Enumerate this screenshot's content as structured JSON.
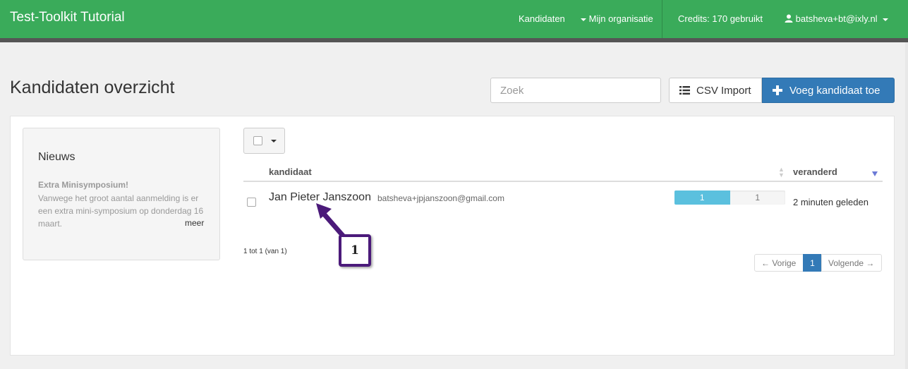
{
  "navbar": {
    "brand": "Test-Toolkit Tutorial",
    "candidates": "Kandidaten",
    "organisation": "Mijn organisatie",
    "credits": "Credits: 170 gebruikt",
    "user": "batsheva+bt@ixly.nl"
  },
  "page": {
    "title": "Kandidaten overzicht",
    "search_placeholder": "Zoek",
    "csv_import": "CSV Import",
    "add_candidate": "Voeg kandidaat toe"
  },
  "news": {
    "title": "Nieuws",
    "headline": "Extra Minisymposium!",
    "body": "Vanwege het groot aantal aanmelding is er een extra mini-symposium op donderdag 16 maart.",
    "more": "meer"
  },
  "table": {
    "headers": {
      "candidate": "kandidaat",
      "changed": "veranderd"
    },
    "rows": [
      {
        "name": "Jan Pieter Janszoon",
        "email": "batsheva+jpjanszoon@gmail.com",
        "progress_done": "1",
        "progress_total": "1",
        "progress_fraction": 0.5,
        "changed": "2 minuten geleden"
      }
    ],
    "count_text": "1 tot 1 (van 1)"
  },
  "pagination": {
    "prev": "← Vorige",
    "current": "1",
    "next": "Volgende →"
  },
  "annotation": {
    "label": "1"
  },
  "colors": {
    "navbar": "#3aab5a",
    "primary": "#337ab7",
    "progress": "#5bc0de",
    "annotation": "#4b1a7a"
  }
}
